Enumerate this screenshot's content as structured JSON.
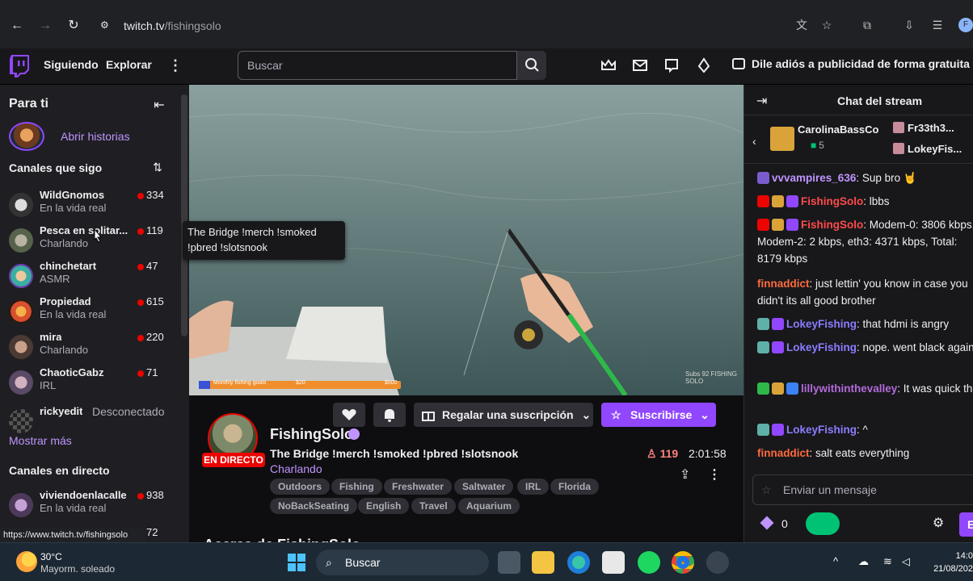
{
  "browser": {
    "url_domain": "twitch.tv",
    "url_path": "/fishingsolo",
    "status_url": "https://www.twitch.tv/fishingsolo"
  },
  "nav": {
    "following": "Siguiendo",
    "browse": "Explorar",
    "search_placeholder": "Buscar",
    "ad_free": "Dile adiós a publicidad de forma gratuita"
  },
  "sidebar": {
    "title": "Para ti",
    "stories_link": "Abrir historias",
    "followed_heading": "Canales que sigo",
    "followed": [
      {
        "name": "WildGnomos",
        "category": "En la vida real",
        "viewers": "334"
      },
      {
        "name": "Pesca en solitar...",
        "category": "Charlando",
        "viewers": "119"
      },
      {
        "name": "chinchetart",
        "category": "ASMR",
        "viewers": "47"
      },
      {
        "name": "Propiedad",
        "category": "En la vida real",
        "viewers": "615"
      },
      {
        "name": "mira",
        "category": "Charlando",
        "viewers": "220"
      },
      {
        "name": "ChaoticGabz",
        "category": "IRL",
        "viewers": "71"
      }
    ],
    "offline_channel": {
      "name": "rickyedit",
      "status": "Desconectado"
    },
    "show_more": "Mostrar más",
    "live_heading": "Canales en directo",
    "live": [
      {
        "name": "viviendoenlacalle",
        "category": "En la vida real",
        "viewers": "938"
      },
      {
        "name": "",
        "category": "",
        "viewers": "72"
      }
    ]
  },
  "tooltip": "The Bridge !merch !smoked !pbred !slotsnook",
  "video": {
    "overlay_left": "Monthly fishing goals",
    "overlay_mid": "$20",
    "overlay_right": "$500",
    "watermark": "Subs 92 FISHING SOLO"
  },
  "stream": {
    "gift_label": "Regalar una suscripción",
    "subscribe_label": "Suscribirse",
    "live_badge": "EN DIRECTO",
    "streamer": "FishingSolo",
    "title": "The Bridge !merch !smoked !pbred !slotsnook",
    "category": "Charlando",
    "viewers": "119",
    "uptime": "2:01:58",
    "tags": [
      "Outdoors",
      "Fishing",
      "Freshwater",
      "Saltwater",
      "IRL",
      "Florida",
      "NoBackSeating",
      "English",
      "Travel",
      "Aquarium"
    ],
    "about": "Acerca de FishingSolo"
  },
  "chat": {
    "title": "Chat del stream",
    "gifter": "CarolinaBassCo",
    "gifter_count": "5",
    "gift_users": [
      "Fr33th3...",
      "LokeyFis..."
    ],
    "messages": [
      {
        "user": "vvvampires_636",
        "color": "#bf94ff",
        "text": ": Sup bro 🤘"
      },
      {
        "user": "FishingSolo",
        "color": "#ff4a4a",
        "text": ": lbbs"
      },
      {
        "user": "FishingSolo",
        "color": "#ff4a4a",
        "text": ": Modem-0: 3806 kbps, Modem-2: 2 kbps, eth3: 4371 kbps, Total: 8179 kbps"
      },
      {
        "user": "finnaddict",
        "color": "#ff6a3d",
        "text": ": just lettin' you know in case you didn't its all good brother"
      },
      {
        "user": "LokeyFishing",
        "color": "#8a7dff",
        "text": ": that hdmi is angry"
      },
      {
        "user": "LokeyFishing",
        "color": "#8a7dff",
        "text": ": nope. went black again"
      },
      {
        "user": "lillywithinthevalley",
        "color": "#b46ad9",
        "text": ": It was quick tho"
      },
      {
        "user": "LokeyFishing",
        "color": "#8a7dff",
        "text": ": ^"
      },
      {
        "user": "finnaddict",
        "color": "#ff6a3d",
        "text": ": salt eats everything"
      }
    ],
    "input_placeholder": "Enviar un mensaje",
    "points": "0",
    "send_label": "Ent"
  },
  "taskbar": {
    "temp": "30°C",
    "weather": "Mayorm. soleado",
    "search": "Buscar",
    "time": "14:0",
    "date": "21/08/202"
  }
}
